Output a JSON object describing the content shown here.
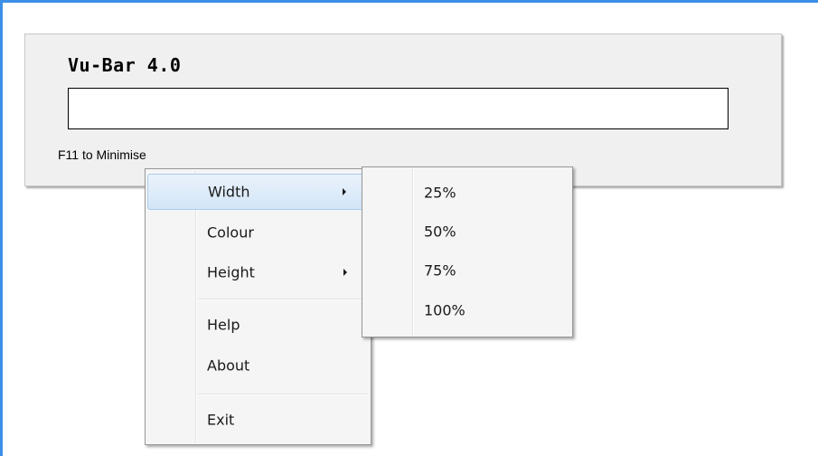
{
  "app": {
    "title": "Vu-Bar 4.0",
    "hint": "F11 to Minimise"
  },
  "context_menu": {
    "items": [
      {
        "label": "Width",
        "has_submenu": true,
        "highlighted": true
      },
      {
        "label": "Colour",
        "has_submenu": false
      },
      {
        "label": "Height",
        "has_submenu": true
      },
      {
        "label": "Help",
        "has_submenu": false
      },
      {
        "label": "About",
        "has_submenu": false
      },
      {
        "label": "Exit",
        "has_submenu": false
      }
    ]
  },
  "width_submenu": {
    "items": [
      {
        "label": "25%"
      },
      {
        "label": "50%"
      },
      {
        "label": "75%"
      },
      {
        "label": "100%"
      }
    ]
  },
  "colors": {
    "frame_accent": "#3c8ee6",
    "panel_bg": "#f0f0f0",
    "menu_bg": "#f5f5f5",
    "highlight_border": "#aeccee"
  }
}
